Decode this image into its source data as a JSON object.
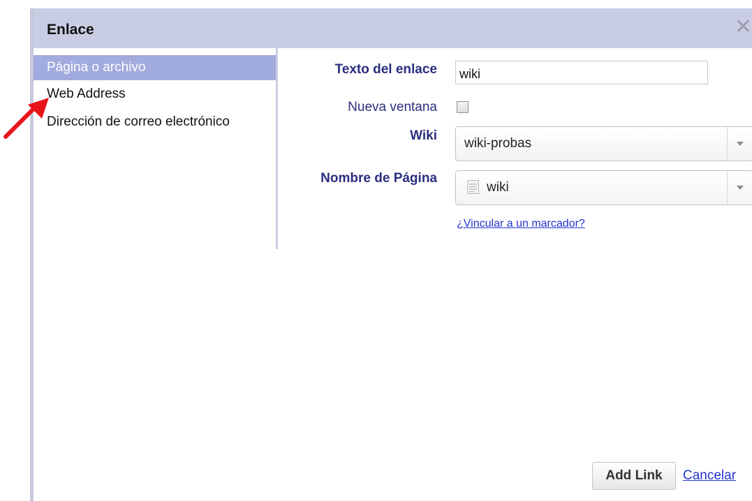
{
  "dialog": {
    "title": "Enlace",
    "close_glyph": "✕"
  },
  "nav": {
    "items": [
      {
        "label": "Página o archivo",
        "active": true
      },
      {
        "label": "Web Address",
        "active": false
      },
      {
        "label": "Dirección de correo electrónico",
        "active": false
      }
    ]
  },
  "form": {
    "link_text_label": "Texto del enlace",
    "link_text_value": "wiki",
    "new_window_label": "Nueva ventana",
    "new_window_checked": false,
    "wiki_label": "Wiki",
    "wiki_value": "wiki-probas",
    "page_name_label": "Nombre de Página",
    "page_name_value": "wiki",
    "page_icon": "document-icon",
    "bookmark_link": "¿Vincular a un marcador?"
  },
  "footer": {
    "add_button": "Add Link",
    "cancel_link": "Cancelar"
  },
  "annotation": {
    "arrow_icon": "red-arrow-icon",
    "arrow_color": "#e8141a"
  },
  "colors": {
    "titlebar": "#c9cde3",
    "active_nav": "#a2abdd",
    "label": "#2a2f7e",
    "link": "#2233cc"
  }
}
